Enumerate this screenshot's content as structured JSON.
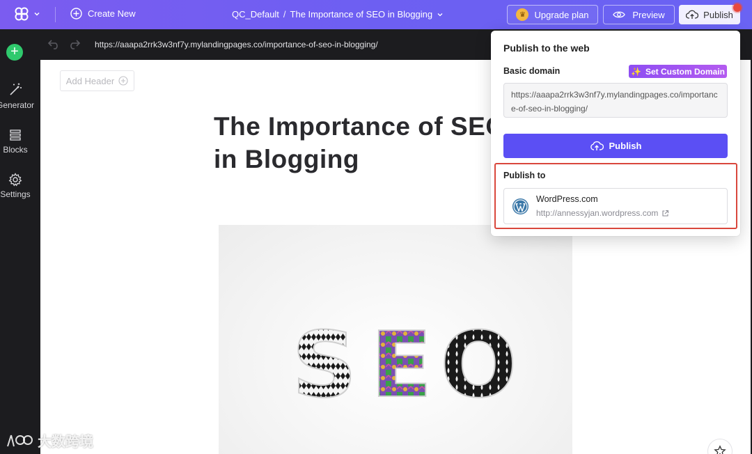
{
  "topbar": {
    "create_new_label": "Create New",
    "breadcrumb_project": "QC_Default",
    "breadcrumb_separator": "/",
    "breadcrumb_page": "The Importance of SEO in Blogging",
    "upgrade_label": "Upgrade plan",
    "preview_label": "Preview",
    "publish_label": "Publish",
    "accent_color": "#6d5ff2"
  },
  "sidebar": {
    "items": [
      {
        "label": "Generator",
        "icon": "magic-wand-icon"
      },
      {
        "label": "Blocks",
        "icon": "blocks-icon"
      },
      {
        "label": "Settings",
        "icon": "gear-icon"
      }
    ]
  },
  "urlbar": {
    "url": "https://aaapa2rrk3w3nf7y.mylandingpages.co/importance-of-seo-in-blogging/"
  },
  "canvas": {
    "add_header_label": "Add Header",
    "page_title": "The Importance of SEO in Blogging",
    "hero_letters": [
      "S",
      "E",
      "O"
    ]
  },
  "popover": {
    "title": "Publish to the web",
    "basic_domain_label": "Basic domain",
    "custom_domain_label": "Set Custom Domain",
    "domain_url": "https://aaapa2rrk3w3nf7y.mylandingpages.co/importance-of-seo-in-blogging/",
    "publish_button_label": "Publish",
    "publish_to_label": "Publish to",
    "wordpress": {
      "name": "WordPress.com",
      "url": "http://annessyjan.wordpress.com"
    },
    "publish_button_color": "#5b4ff4",
    "highlight_color": "#d9473c"
  },
  "watermark": {
    "text": "大数跨境"
  }
}
